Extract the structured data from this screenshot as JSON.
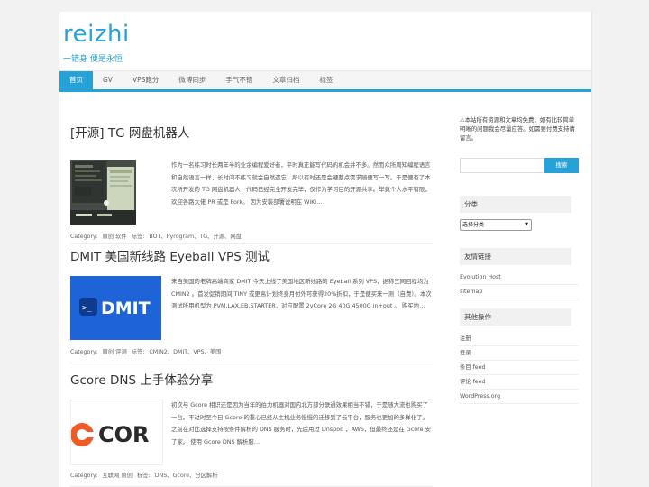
{
  "site": {
    "title": "reizhi",
    "tagline": "一错身 便是永恒"
  },
  "nav": {
    "items": [
      "首页",
      "GV",
      "VPS跑分",
      "微博同步",
      "手气不错",
      "文章归档",
      "标签"
    ]
  },
  "posts": [
    {
      "title": "[开源] TG 网盘机器人",
      "excerpt": "作为一名练习时长两年半的业余编程爱好者，平时真正能写代码的机会并不多。然而众所周知编程语言和自然语言一样，长时间不练习就会自然遗忘，所以有时还是会硬整点需求随便写一写。于是便有了本次所开发的 TG 网盘机器人，代码已经完全开发完毕，仅作为学习目的开源共享。毕竟个人水平有限，欢迎各路大佬 PR 或是 Fork。 因为安装部署说明在 WiKi…",
      "category_label": "Category:",
      "categories": "原创  软件",
      "tags_label": "标签:",
      "tags": "BOT、Pyrogram、TG、开源、网盘"
    },
    {
      "title": "DMIT 美国新线路 Eyeball VPS 测试",
      "excerpt": "来自美国的老牌高端商家 DMIT 今天上线了美国地区新线路的 Eyeball 系列 VPS，据称三网回程均为 CMIN2 。首发促销期间 TINY 或更高计划终身月付外可获得20%折扣，于是便买来一测（自费）。本次测试所用机型为 PVM.LAX.EB.STARTER，对应配置 2vCore 2G 40G 4500G in+out 。 购买地…",
      "category_label": "Category:",
      "categories": "原创  评测",
      "tags_label": "标签:",
      "tags": "CMIN2、DMIT、VPS、美国"
    },
    {
      "title": "Gcore DNS 上手体验分享",
      "excerpt": "初次与 Gcore 相识还是因为当年的伯力机器对国内北方部分联通效果相当不错，于是随大流也购买了一台。不过时至今日 Gcore 的重心已经从主机业务慢慢的迁移到了云平台，服务也更加的多样化了。之前在对比选择支持按条件解析的 DNS 服务时，先后用过 Dnspod ，AWS，但最终还是在 Gcore 安了家。 使用 Gcore DNS 解析服…",
      "category_label": "Category:",
      "categories": "互联网  原创",
      "tags_label": "标签:",
      "tags": "DNS、Gcore、分区解析"
    }
  ],
  "sidebar": {
    "notice": "⚠本站所有资源和文章均免费，如有比较简单明晰的问题我会尽量应答。如需要付费支持请留言。",
    "search_button": "搜索",
    "categories_title": "分类",
    "categories_select": "选择分类",
    "links_title": "友情链接",
    "links": [
      "Evolution Host",
      "sitemap"
    ],
    "other_title": "其他操作",
    "other": [
      "注册",
      "登录",
      "条目 feed",
      "评论 feed",
      "WordPress.org"
    ]
  },
  "thumbnails": {
    "dmit_text": "DMIT",
    "dmit_prompt": ">_",
    "gcore_text": "COR",
    "tg_label": "GUL Bot."
  },
  "colors": {
    "accent": "#27a2d8",
    "dmit_bg": "#1f63d8",
    "gcore_orange": "#f15a24"
  }
}
